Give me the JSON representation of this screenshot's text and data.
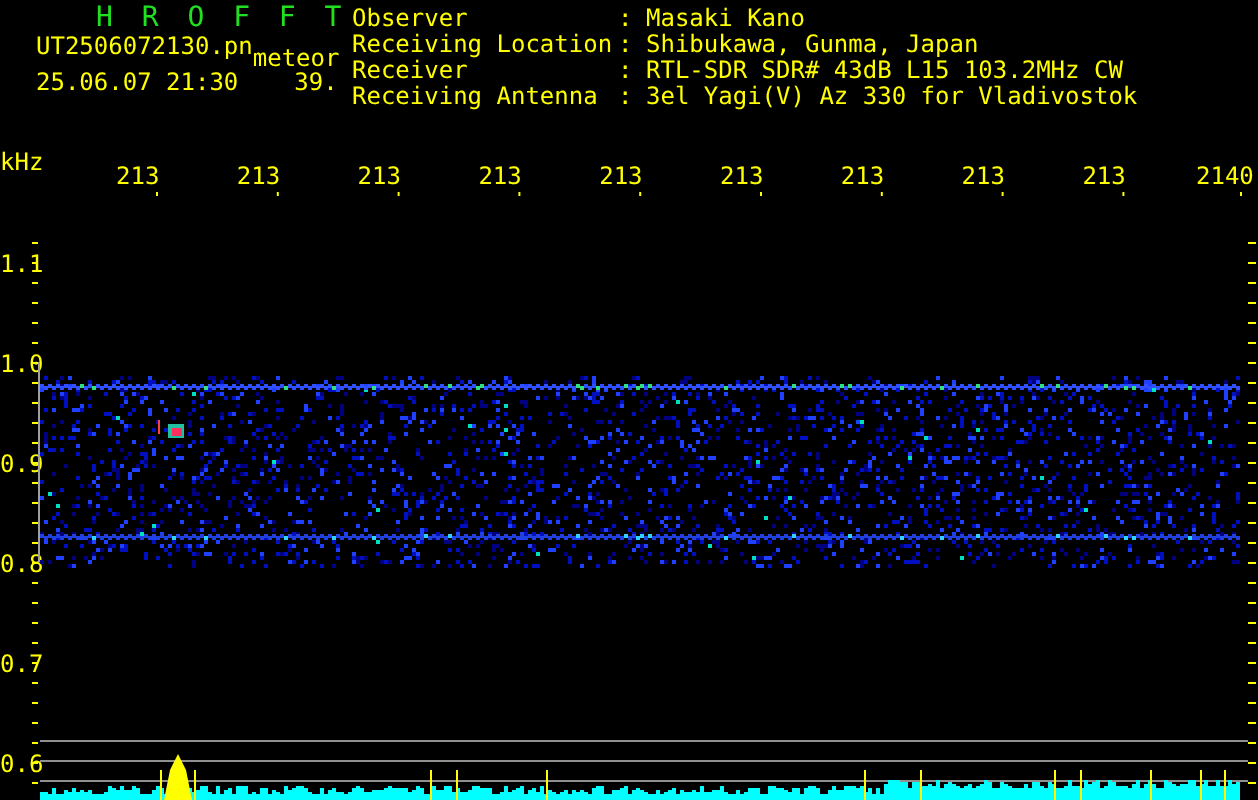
{
  "header": {
    "title": "H R O F F T",
    "file_name": "UT2506072130.pn",
    "type": "meteor",
    "timestamp": "25.06.07 21:30",
    "count": "39.",
    "fields": [
      {
        "label": "Observer",
        "separator": ":",
        "value": "Masaki Kano"
      },
      {
        "label": "Receiving Location",
        "separator": ":",
        "value": "Shibukawa, Gunma, Japan"
      },
      {
        "label": "Receiver",
        "separator": ":",
        "value": "RTL-SDR SDR# 43dB L15 103.2MHz CW"
      },
      {
        "label": "Receiving Antenna",
        "separator": ":",
        "value": "3el Yagi(V) Az 330 for Vladivostok"
      }
    ]
  },
  "waterfall": {
    "unit": "kHz",
    "time_labels": [
      "213",
      "213",
      "213",
      "213",
      "213",
      "213",
      "213",
      "213",
      "213",
      "2140"
    ],
    "freq_labels": [
      "1.1",
      "1.0",
      "0.9",
      "0.8",
      "0.7",
      "0.6"
    ]
  }
}
